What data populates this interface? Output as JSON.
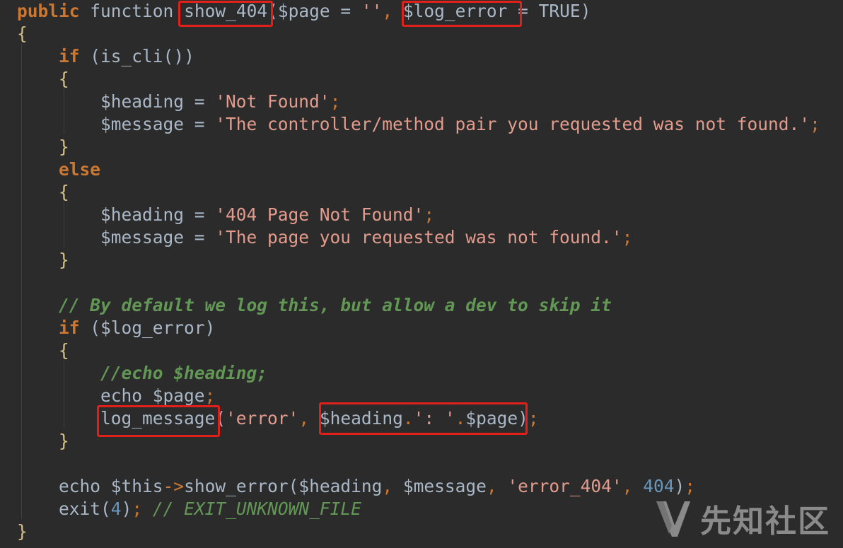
{
  "editor": {
    "theme": {
      "background": "#2b2b2b",
      "keyword": "#cc7832",
      "string": "#e39b8d",
      "number": "#6897bb",
      "comment": "#629755",
      "text": "#a9b7c6",
      "brace": "#d4bf8a",
      "highlight": "#e0201b"
    },
    "lines": [
      {
        "tokens": [
          {
            "t": "public",
            "c": "kw"
          },
          {
            "t": " ",
            "c": "plain"
          },
          {
            "t": "function",
            "c": "plain"
          },
          {
            "t": " ",
            "c": "plain"
          },
          {
            "t": "show_404",
            "c": "fn"
          },
          {
            "t": "(",
            "c": "paren"
          },
          {
            "t": "$page",
            "c": "var"
          },
          {
            "t": " = ",
            "c": "plain"
          },
          {
            "t": "''",
            "c": "str2"
          },
          {
            "t": ", ",
            "c": "punct"
          },
          {
            "t": "$log_error",
            "c": "var"
          },
          {
            "t": " = TRUE",
            "c": "plain"
          },
          {
            "t": ")",
            "c": "paren"
          }
        ]
      },
      {
        "tokens": [
          {
            "t": "{",
            "c": "brace"
          }
        ]
      },
      {
        "tokens": [
          {
            "t": "    ",
            "c": "plain"
          },
          {
            "t": "if",
            "c": "kw"
          },
          {
            "t": " (",
            "c": "paren"
          },
          {
            "t": "is_cli",
            "c": "fn"
          },
          {
            "t": "())",
            "c": "paren"
          }
        ]
      },
      {
        "tokens": [
          {
            "t": "    ",
            "c": "plain"
          },
          {
            "t": "{",
            "c": "brace"
          }
        ]
      },
      {
        "tokens": [
          {
            "t": "        ",
            "c": "plain"
          },
          {
            "t": "$heading",
            "c": "var"
          },
          {
            "t": " = ",
            "c": "plain"
          },
          {
            "t": "'Not Found'",
            "c": "str2"
          },
          {
            "t": ";",
            "c": "punct"
          }
        ]
      },
      {
        "tokens": [
          {
            "t": "        ",
            "c": "plain"
          },
          {
            "t": "$message",
            "c": "var"
          },
          {
            "t": " = ",
            "c": "plain"
          },
          {
            "t": "'The controller/method pair you requested was not found.'",
            "c": "str2"
          },
          {
            "t": ";",
            "c": "punct"
          }
        ]
      },
      {
        "tokens": [
          {
            "t": "    ",
            "c": "plain"
          },
          {
            "t": "}",
            "c": "brace"
          }
        ]
      },
      {
        "tokens": [
          {
            "t": "    ",
            "c": "plain"
          },
          {
            "t": "else",
            "c": "kw"
          }
        ]
      },
      {
        "tokens": [
          {
            "t": "    ",
            "c": "plain"
          },
          {
            "t": "{",
            "c": "brace"
          }
        ]
      },
      {
        "tokens": [
          {
            "t": "        ",
            "c": "plain"
          },
          {
            "t": "$heading",
            "c": "var"
          },
          {
            "t": " = ",
            "c": "plain"
          },
          {
            "t": "'404 Page Not Found'",
            "c": "str2"
          },
          {
            "t": ";",
            "c": "punct"
          }
        ]
      },
      {
        "tokens": [
          {
            "t": "        ",
            "c": "plain"
          },
          {
            "t": "$message",
            "c": "var"
          },
          {
            "t": " = ",
            "c": "plain"
          },
          {
            "t": "'The page you requested was not found.'",
            "c": "str2"
          },
          {
            "t": ";",
            "c": "punct"
          }
        ]
      },
      {
        "tokens": [
          {
            "t": "    ",
            "c": "plain"
          },
          {
            "t": "}",
            "c": "brace"
          }
        ]
      },
      {
        "tokens": []
      },
      {
        "tokens": [
          {
            "t": "    ",
            "c": "plain"
          },
          {
            "t": "// By default we log this, but allow a dev to skip it",
            "c": "comb"
          }
        ]
      },
      {
        "tokens": [
          {
            "t": "    ",
            "c": "plain"
          },
          {
            "t": "if",
            "c": "kw"
          },
          {
            "t": " (",
            "c": "paren"
          },
          {
            "t": "$log_error",
            "c": "var"
          },
          {
            "t": ")",
            "c": "paren"
          }
        ]
      },
      {
        "tokens": [
          {
            "t": "    ",
            "c": "plain"
          },
          {
            "t": "{",
            "c": "brace"
          }
        ]
      },
      {
        "tokens": [
          {
            "t": "        ",
            "c": "plain"
          },
          {
            "t": "//echo $heading;",
            "c": "comb"
          }
        ]
      },
      {
        "tokens": [
          {
            "t": "        ",
            "c": "plain"
          },
          {
            "t": "echo",
            "c": "plain"
          },
          {
            "t": " $page",
            "c": "var"
          },
          {
            "t": ";",
            "c": "punct"
          }
        ]
      },
      {
        "tokens": [
          {
            "t": "        ",
            "c": "plain"
          },
          {
            "t": "log_message",
            "c": "fn"
          },
          {
            "t": "(",
            "c": "paren"
          },
          {
            "t": "'error'",
            "c": "str2"
          },
          {
            "t": ", ",
            "c": "punct"
          },
          {
            "t": "$heading",
            "c": "var"
          },
          {
            "t": ".",
            "c": "punct"
          },
          {
            "t": "': '",
            "c": "str2"
          },
          {
            "t": ".",
            "c": "punct"
          },
          {
            "t": "$page",
            "c": "var"
          },
          {
            "t": ")",
            "c": "paren"
          },
          {
            "t": ";",
            "c": "punct"
          }
        ]
      },
      {
        "tokens": [
          {
            "t": "    ",
            "c": "plain"
          },
          {
            "t": "}",
            "c": "brace"
          }
        ]
      },
      {
        "tokens": []
      },
      {
        "tokens": [
          {
            "t": "    ",
            "c": "plain"
          },
          {
            "t": "echo",
            "c": "plain"
          },
          {
            "t": " $this",
            "c": "var"
          },
          {
            "t": "->",
            "c": "punct"
          },
          {
            "t": "show_error",
            "c": "fn"
          },
          {
            "t": "(",
            "c": "paren"
          },
          {
            "t": "$heading",
            "c": "var"
          },
          {
            "t": ", ",
            "c": "punct"
          },
          {
            "t": "$message",
            "c": "var"
          },
          {
            "t": ", ",
            "c": "punct"
          },
          {
            "t": "'error_404'",
            "c": "str2"
          },
          {
            "t": ", ",
            "c": "punct"
          },
          {
            "t": "404",
            "c": "num"
          },
          {
            "t": ")",
            "c": "paren"
          },
          {
            "t": ";",
            "c": "punct"
          }
        ]
      },
      {
        "tokens": [
          {
            "t": "    ",
            "c": "plain"
          },
          {
            "t": "exit",
            "c": "fn"
          },
          {
            "t": "(",
            "c": "paren"
          },
          {
            "t": "4",
            "c": "num"
          },
          {
            "t": ")",
            "c": "paren"
          },
          {
            "t": "; ",
            "c": "punct"
          },
          {
            "t": "// EXIT_UNKNOWN_FILE",
            "c": "com"
          }
        ]
      },
      {
        "tokens": [
          {
            "t": "}",
            "c": "brace"
          }
        ]
      }
    ]
  },
  "watermark": {
    "text": "先知社区",
    "logo_icon": "xianzhi-logo-icon"
  }
}
